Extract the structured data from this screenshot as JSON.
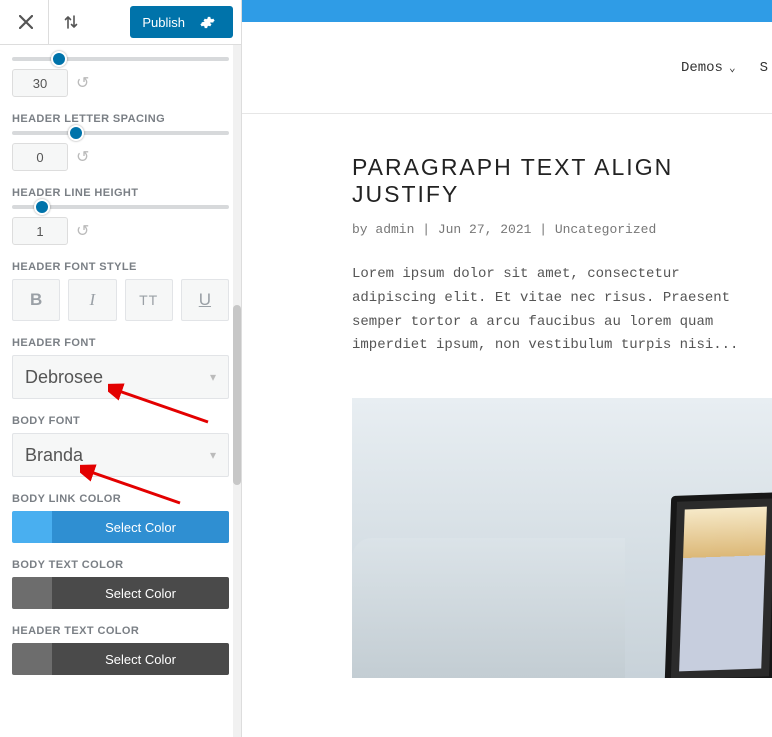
{
  "toolbar": {
    "close_icon": "close-icon",
    "sort_icon": "sort-icon",
    "publish_label": "Publish",
    "settings_icon": "gear-icon"
  },
  "controls": {
    "partial": {
      "value": "30",
      "thumb_pct": 18
    },
    "header_letter_spacing": {
      "label": "HEADER LETTER SPACING",
      "value": "0",
      "thumb_pct": 26
    },
    "header_line_height": {
      "label": "HEADER LINE HEIGHT",
      "value": "1",
      "thumb_pct": 10
    },
    "header_font_style": {
      "label": "HEADER FONT STYLE",
      "buttons": {
        "bold": "B",
        "italic": "I",
        "uppercase": "TT",
        "underline": "U"
      }
    },
    "header_font": {
      "label": "HEADER FONT",
      "value": "Debrosee"
    },
    "body_font": {
      "label": "BODY FONT",
      "value": "Branda"
    },
    "body_link_color": {
      "label": "BODY LINK COLOR",
      "swatch": "#49aff0",
      "bar": "#2f8fd2",
      "text": "Select Color"
    },
    "body_text_color": {
      "label": "BODY TEXT COLOR",
      "swatch": "#6d6d6d",
      "bar": "#4a4a4a",
      "text": "Select Color"
    },
    "header_text_color": {
      "label": "HEADER TEXT COLOR",
      "swatch": "#6d6d6d",
      "bar": "#4a4a4a",
      "text": "Select Color"
    }
  },
  "preview": {
    "nav": {
      "item1": "Demos",
      "item2_partial": "S"
    },
    "post_title": "PARAGRAPH TEXT ALIGN JUSTIFY",
    "post_meta": "by admin | Jun 27, 2021 | Uncategorized",
    "post_body": "Lorem ipsum dolor sit amet, consectetur adipiscing elit. Et vitae nec risus. Praesent semper tortor a arcu faucibus au lorem quam imperdiet ipsum, non vestibulum turpis nisi..."
  }
}
